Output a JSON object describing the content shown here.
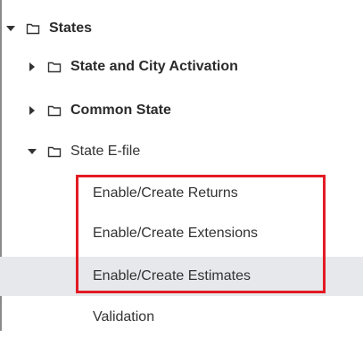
{
  "tree": {
    "root": {
      "label": "States",
      "expanded": true,
      "icon": "folder-icon"
    },
    "children": [
      {
        "label": "State and City Activation",
        "expanded": false,
        "bold": true
      },
      {
        "label": "Common State",
        "expanded": false,
        "bold": true
      },
      {
        "label": "State E-file",
        "expanded": true,
        "bold": false
      }
    ],
    "efile_items": [
      {
        "label": "Enable/Create Returns",
        "selected": false
      },
      {
        "label": "Enable/Create Extensions",
        "selected": false
      },
      {
        "label": "Enable/Create Estimates",
        "selected": true
      },
      {
        "label": "Validation",
        "selected": false
      }
    ]
  },
  "colors": {
    "highlight_border": "#e31b23",
    "selected_row_bg": "#e6e8eb",
    "text": "#333333",
    "icon": "#333333"
  }
}
